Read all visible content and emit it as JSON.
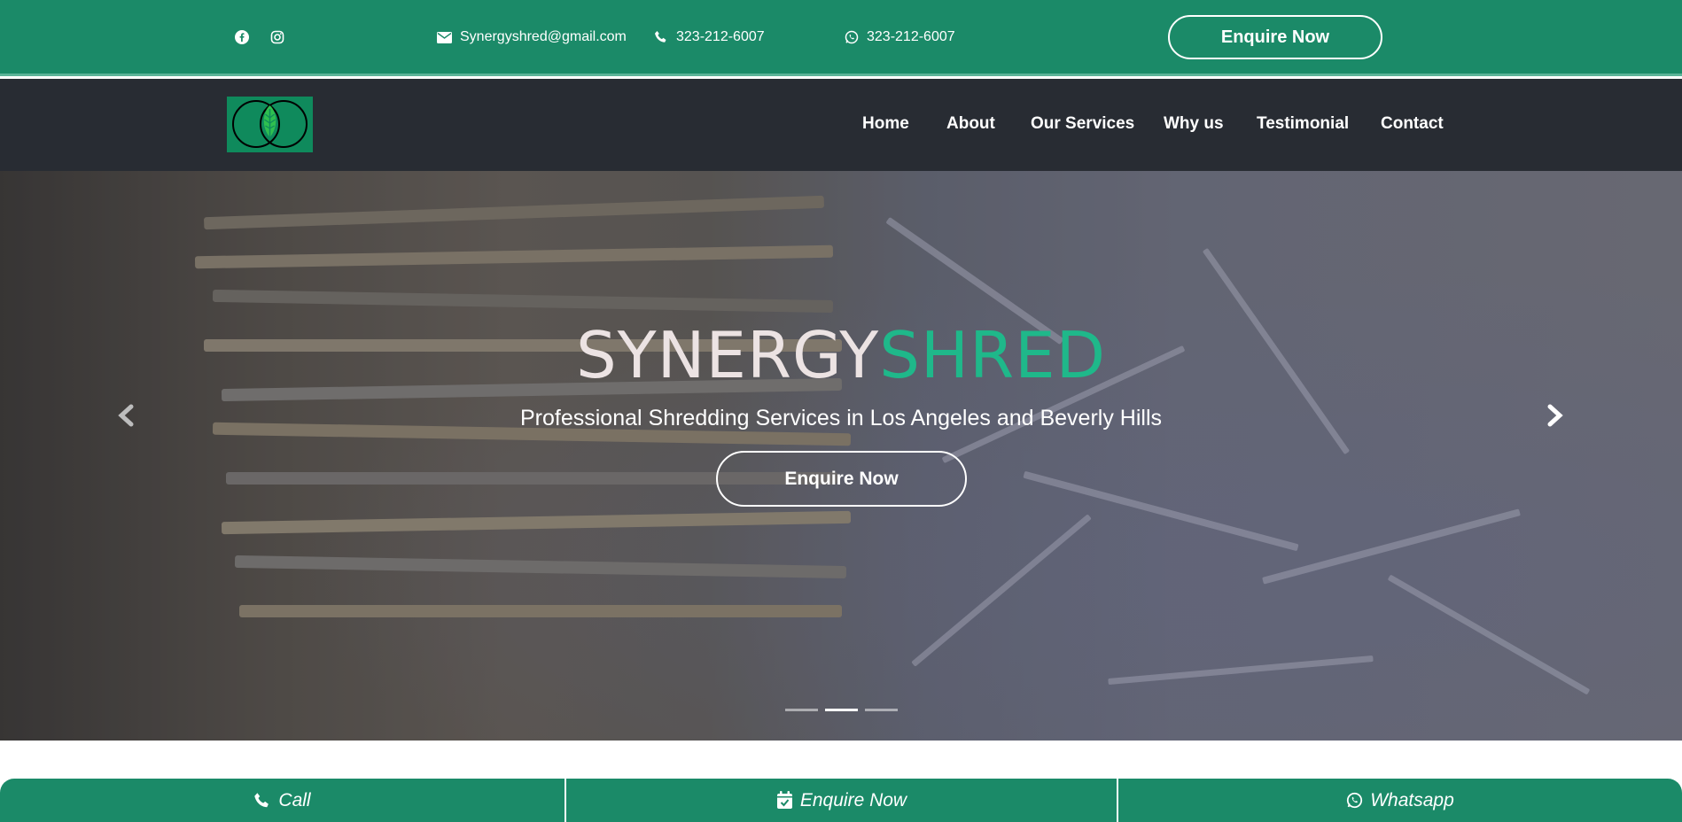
{
  "colors": {
    "brand_green": "#1b8a68",
    "accent_green": "#1fb88a",
    "nav_dark": "#282c33"
  },
  "topbar": {
    "social": [
      {
        "icon": "facebook-icon"
      },
      {
        "icon": "instagram-icon"
      }
    ],
    "email": "Synergyshred@gmail.com",
    "phone": "323-212-6007",
    "whatsapp": "323-212-6007",
    "enquire_label": "Enquire Now"
  },
  "nav": {
    "logo_icon": "leaf-logo-icon",
    "items": [
      "Home",
      "About",
      "Our Services",
      "Why us",
      "Testimonial",
      "Contact"
    ]
  },
  "hero": {
    "title_part1": "SYNERGY",
    "title_part2": "SHRED",
    "subtitle": "Professional Shredding Services in Los Angeles and Beverly Hills",
    "enquire_label": "Enquire Now",
    "slides_count": 3,
    "active_slide": 2
  },
  "bottom_bar": [
    {
      "icon": "phone-icon",
      "label": "Call"
    },
    {
      "icon": "calendar-check-icon",
      "label": "Enquire Now"
    },
    {
      "icon": "whatsapp-icon",
      "label": "Whatsapp"
    }
  ]
}
